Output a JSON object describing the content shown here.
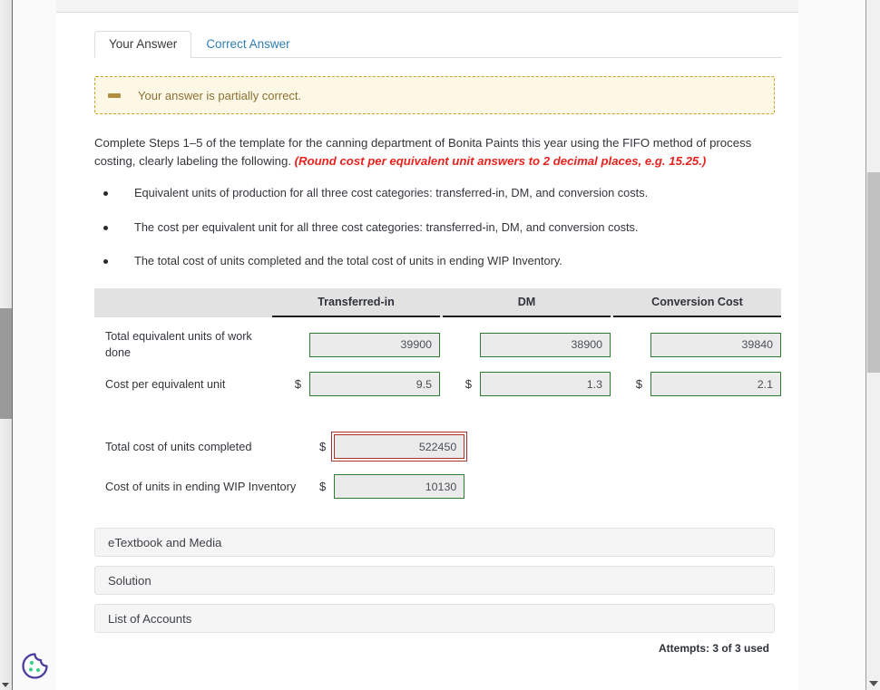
{
  "tabs": [
    {
      "label": "Your Answer",
      "active": true
    },
    {
      "label": "Correct Answer",
      "active": false
    }
  ],
  "alert": {
    "icon": "minus-dash-icon",
    "message": "Your answer is partially correct.",
    "background_color": "#fdf7e6",
    "border_color": "#c9a227",
    "text_color": "#8a7133"
  },
  "instructions": {
    "main": "Complete Steps 1–5 of the template for the canning department of Bonita Paints this year using the FIFO method of process costing, clearly labeling the following.",
    "hint": "(Round cost per equivalent unit answers to 2 decimal places, e.g. 15.25.)",
    "hint_color": "#e8221d"
  },
  "bullets": [
    "Equivalent units of production for all three cost categories: transferred-in, DM, and conversion costs.",
    "The cost per equivalent unit for all three cost categories: transferred-in, DM, and conversion costs.",
    "The total cost of units completed and the total cost of units in ending WIP Inventory."
  ],
  "table": {
    "columns": [
      "Transferred-in",
      "DM",
      "Conversion Cost"
    ],
    "rows": [
      {
        "label": "Total equivalent units of work done",
        "has_dollar": false,
        "cells": [
          {
            "value": "39900",
            "state": "correct"
          },
          {
            "value": "38900",
            "state": "correct"
          },
          {
            "value": "39840",
            "state": "correct"
          }
        ]
      },
      {
        "label": "Cost per equivalent unit",
        "has_dollar": true,
        "dollar": "$",
        "cells": [
          {
            "value": "9.5",
            "state": "correct"
          },
          {
            "value": "1.3",
            "state": "correct"
          },
          {
            "value": "2.1",
            "state": "correct"
          }
        ]
      }
    ]
  },
  "totals": [
    {
      "label": "Total cost of units completed",
      "dollar": "$",
      "value": "522450",
      "state": "incorrect"
    },
    {
      "label": "Cost of units in ending WIP Inventory",
      "dollar": "$",
      "value": "10130",
      "state": "correct"
    }
  ],
  "accordions": [
    "eTextbook and Media",
    "Solution",
    "List of Accounts"
  ],
  "attempts": "Attempts: 3 of 3 used",
  "colors": {
    "correct_border": "#2f7d32",
    "incorrect_border": "#a83232",
    "input_background": "#ebebeb",
    "tab_link": "#2f7fb5",
    "header_background": "#e2e2e2"
  },
  "cookie_icon": {
    "name": "cookie-consent-icon",
    "outline_color": "#4a3f9e",
    "dot_color": "#3ecf8e"
  }
}
